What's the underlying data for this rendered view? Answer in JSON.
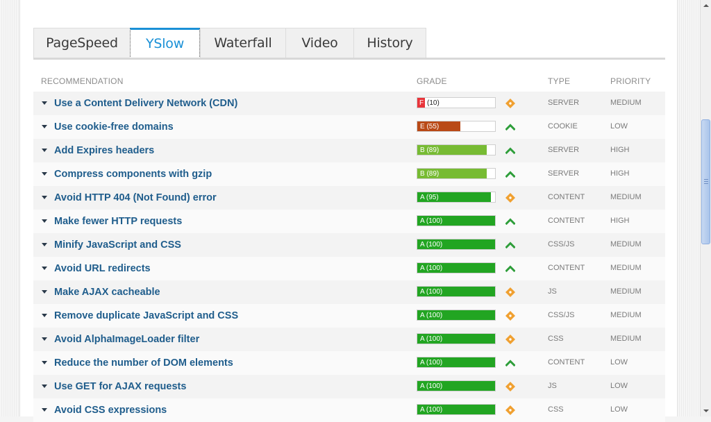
{
  "tabs": [
    {
      "label": "PageSpeed",
      "active": false
    },
    {
      "label": "YSlow",
      "active": true
    },
    {
      "label": "Waterfall",
      "active": false
    },
    {
      "label": "Video",
      "active": false
    },
    {
      "label": "History",
      "active": false
    }
  ],
  "headers": {
    "recommendation": "RECOMMENDATION",
    "grade": "GRADE",
    "type": "TYPE",
    "priority": "PRIORITY"
  },
  "colors": {
    "F": "#e8343a",
    "E": "#b94a17",
    "B": "#77bb33",
    "A": "#22a522",
    "link": "#1f5d8c",
    "tab_active": "#1a90d6"
  },
  "rows": [
    {
      "label": "Use a Content Delivery Network (CDN)",
      "grade_text": "(10)",
      "grade_letter": "F",
      "score": 10,
      "indicator": "diamond-icon",
      "type": "SERVER",
      "priority": "MEDIUM"
    },
    {
      "label": "Use cookie-free domains",
      "grade_text": "E (55)",
      "grade_letter": "E",
      "score": 55,
      "indicator": "up-chevron-icon",
      "type": "COOKIE",
      "priority": "LOW"
    },
    {
      "label": "Add Expires headers",
      "grade_text": "B (89)",
      "grade_letter": "B",
      "score": 89,
      "indicator": "up-chevron-icon",
      "type": "SERVER",
      "priority": "HIGH"
    },
    {
      "label": "Compress components with gzip",
      "grade_text": "B (89)",
      "grade_letter": "B",
      "score": 89,
      "indicator": "up-chevron-icon",
      "type": "SERVER",
      "priority": "HIGH"
    },
    {
      "label": "Avoid HTTP 404 (Not Found) error",
      "grade_text": "A (95)",
      "grade_letter": "A",
      "score": 95,
      "indicator": "diamond-icon",
      "type": "CONTENT",
      "priority": "MEDIUM"
    },
    {
      "label": "Make fewer HTTP requests",
      "grade_text": "A (100)",
      "grade_letter": "A",
      "score": 100,
      "indicator": "up-chevron-icon",
      "type": "CONTENT",
      "priority": "HIGH"
    },
    {
      "label": "Minify JavaScript and CSS",
      "grade_text": "A (100)",
      "grade_letter": "A",
      "score": 100,
      "indicator": "up-chevron-icon",
      "type": "CSS/JS",
      "priority": "MEDIUM"
    },
    {
      "label": "Avoid URL redirects",
      "grade_text": "A (100)",
      "grade_letter": "A",
      "score": 100,
      "indicator": "up-chevron-icon",
      "type": "CONTENT",
      "priority": "MEDIUM"
    },
    {
      "label": "Make AJAX cacheable",
      "grade_text": "A (100)",
      "grade_letter": "A",
      "score": 100,
      "indicator": "diamond-icon",
      "type": "JS",
      "priority": "MEDIUM"
    },
    {
      "label": "Remove duplicate JavaScript and CSS",
      "grade_text": "A (100)",
      "grade_letter": "A",
      "score": 100,
      "indicator": "diamond-icon",
      "type": "CSS/JS",
      "priority": "MEDIUM"
    },
    {
      "label": "Avoid AlphaImageLoader filter",
      "grade_text": "A (100)",
      "grade_letter": "A",
      "score": 100,
      "indicator": "diamond-icon",
      "type": "CSS",
      "priority": "MEDIUM"
    },
    {
      "label": "Reduce the number of DOM elements",
      "grade_text": "A (100)",
      "grade_letter": "A",
      "score": 100,
      "indicator": "up-chevron-icon",
      "type": "CONTENT",
      "priority": "LOW"
    },
    {
      "label": "Use GET for AJAX requests",
      "grade_text": "A (100)",
      "grade_letter": "A",
      "score": 100,
      "indicator": "diamond-icon",
      "type": "JS",
      "priority": "LOW"
    },
    {
      "label": "Avoid CSS expressions",
      "grade_text": "A (100)",
      "grade_letter": "A",
      "score": 100,
      "indicator": "diamond-icon",
      "type": "CSS",
      "priority": "LOW"
    }
  ]
}
